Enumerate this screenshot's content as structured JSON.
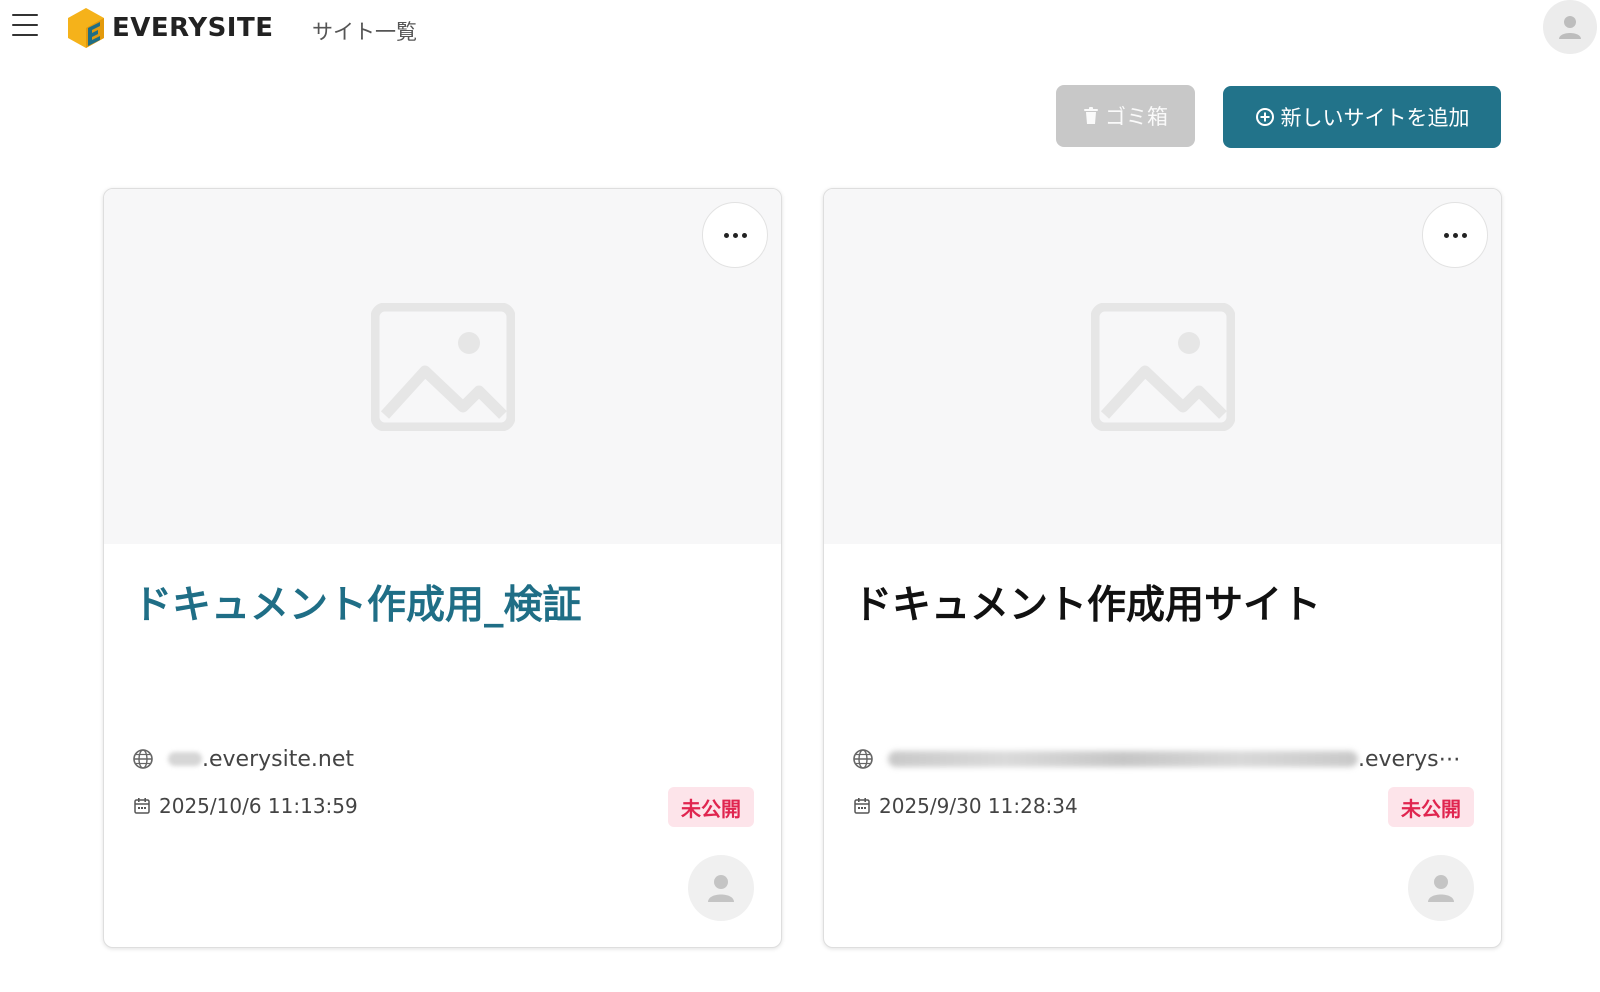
{
  "header": {
    "logo_text": "EVERYSITE",
    "page_title": "サイト一覧",
    "icons": {
      "menu": "hamburger-icon",
      "logo": "everysite-logo-icon",
      "user": "user-icon"
    }
  },
  "actions": {
    "trash_label": "ゴミ箱",
    "add_label": "新しいサイトを追加",
    "icons": {
      "trash": "trash-icon",
      "add": "plus-circle-icon"
    }
  },
  "sites": [
    {
      "title": "ドキュメント作成用_検証",
      "domain_suffix": ".everysite.net",
      "date": "2025/10/6 11:13:59",
      "status": "未公開"
    },
    {
      "title": "ドキュメント作成用サイト",
      "domain_suffix": ".everys⋯",
      "date": "2025/9/30 11:28:34",
      "status": "未公開"
    }
  ],
  "colors": {
    "primary": "#22738a",
    "title_link": "#1f6e86",
    "trash_button": "#c8c8c8",
    "badge_bg": "#fde4ea",
    "badge_text": "#e0254f",
    "logo_yellow": "#f5b21a",
    "logo_teal": "#1f6e86"
  }
}
